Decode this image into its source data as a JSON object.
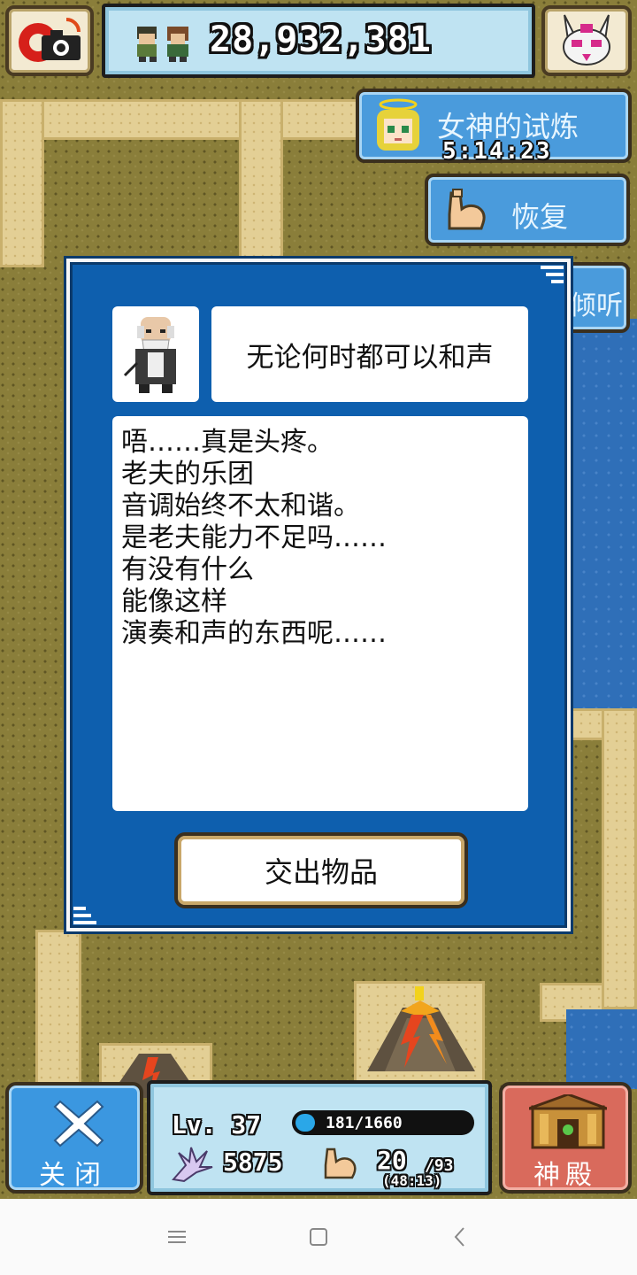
{
  "header": {
    "money": "28,932,381",
    "camera_icon": "camera-icon",
    "heroes_icon": "heroes-icon",
    "bunny_icon": "bunny-mask-icon"
  },
  "side_buttons": {
    "goddess_trial": {
      "label": "女神的试炼",
      "timer": "5:14:23"
    },
    "recover": {
      "label": "恢复"
    },
    "listen": {
      "label": "倾听"
    }
  },
  "dialog": {
    "title": "无论何时都可以和声",
    "message_lines": [
      "唔……真是头疼。",
      "老夫的乐团",
      "音调始终不太和谐。",
      "是老夫能力不足吗……",
      "有没有什么",
      "能像这样",
      "演奏和声的东西呢……"
    ],
    "action_button": "交出物品"
  },
  "hud": {
    "close_label": "关闭",
    "level": "Lv. 37",
    "exp_text": "181/1660",
    "exp_fraction": 0.109,
    "power": "5875",
    "stamina_current": "20",
    "stamina_max": "/93",
    "stamina_timer": "(48:13)",
    "temple_label": "神殿"
  },
  "colors": {
    "dialog_blue": "#0e5fae",
    "button_blue": "#4a9bdc",
    "temple_red": "#d96a5c",
    "panel_light_blue": "#bfe3f2"
  }
}
